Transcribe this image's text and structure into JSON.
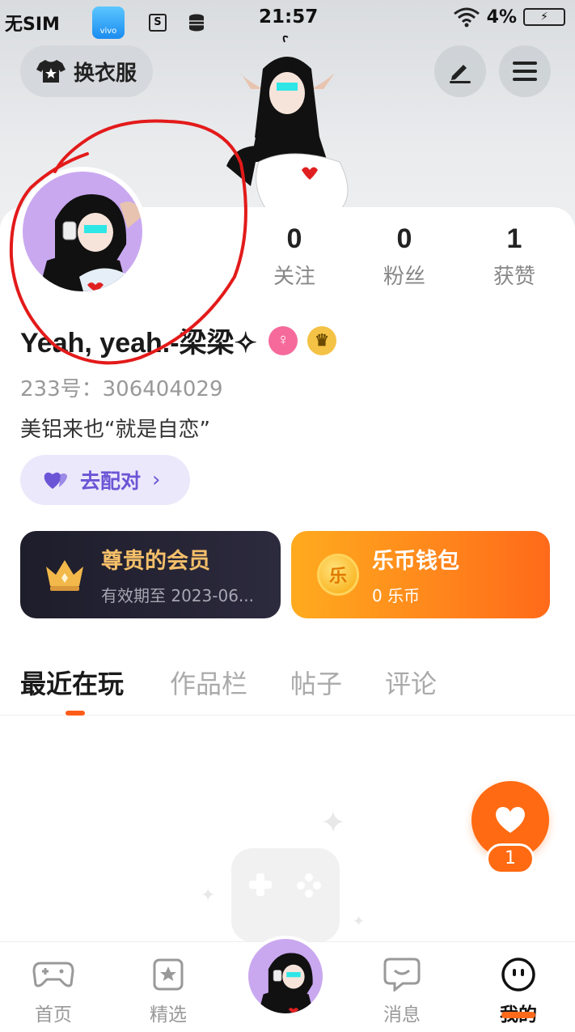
{
  "status_bar": {
    "carrier": "无SIM",
    "app_icon_label": "vivo",
    "time": "21:57",
    "battery": "4%"
  },
  "header": {
    "outfit_label": "换衣服"
  },
  "stats": [
    {
      "count": "0",
      "label": "关注"
    },
    {
      "count": "0",
      "label": "粉丝"
    },
    {
      "count": "1",
      "label": "获赞"
    }
  ],
  "profile": {
    "nickname": "Yeah, yeah.-梁梁✧",
    "id_text": "233号：306404029",
    "bio": "美铝来也“就是自恋”",
    "match_label": "去配对"
  },
  "cards": {
    "vip_title": "尊贵的会员",
    "vip_sub": "有效期至 2023-06...",
    "coin_title": "乐币钱包",
    "coin_sub": "0 乐币",
    "coin_glyph": "乐"
  },
  "tabs": [
    "最近在玩",
    "作品栏",
    "帖子",
    "评论"
  ],
  "like": {
    "count": "1"
  },
  "bottom_nav": [
    "首页",
    "精选",
    "消息",
    "我的"
  ],
  "colors": {
    "accent": "#ff6a1a",
    "vip_gold": "#f6c06a",
    "match_purple": "#6b55d6"
  }
}
